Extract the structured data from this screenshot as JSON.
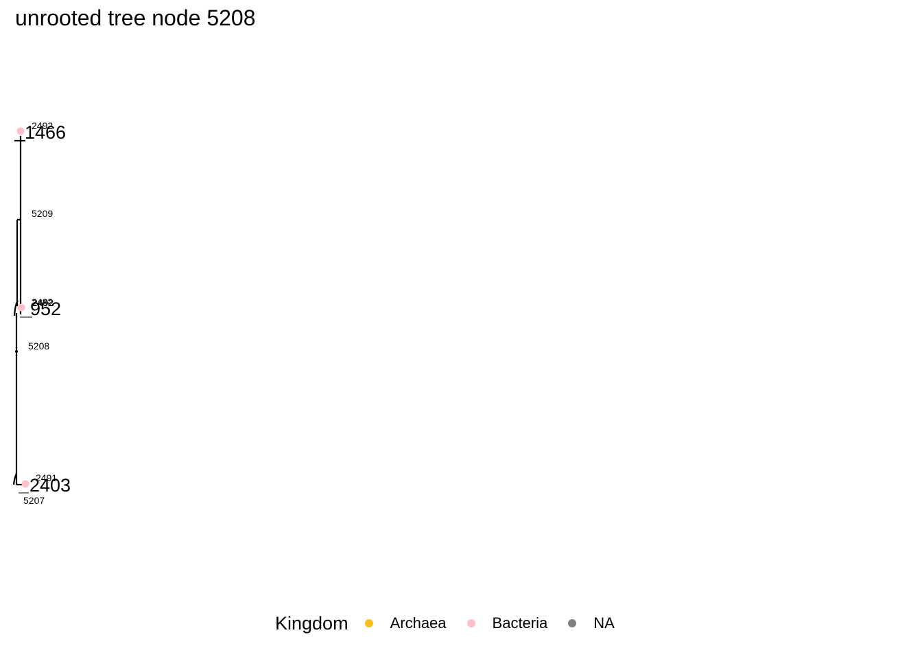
{
  "title": "unrooted tree node 5208",
  "tips": [
    {
      "label": "1466",
      "kingdom": "Bacteria"
    },
    {
      "label": "952",
      "kingdom": "Bacteria"
    },
    {
      "label": "2403",
      "kingdom": "Bacteria"
    }
  ],
  "node_labels": [
    "2492",
    "5209",
    "2482",
    "2492",
    "5208",
    "2491",
    "5207"
  ],
  "legend": {
    "title": "Kingdom",
    "items": [
      {
        "label": "Archaea",
        "color": "#fbbf24"
      },
      {
        "label": "Bacteria",
        "color": "#ffc0cb"
      },
      {
        "label": "NA",
        "color": "#808080"
      }
    ]
  }
}
